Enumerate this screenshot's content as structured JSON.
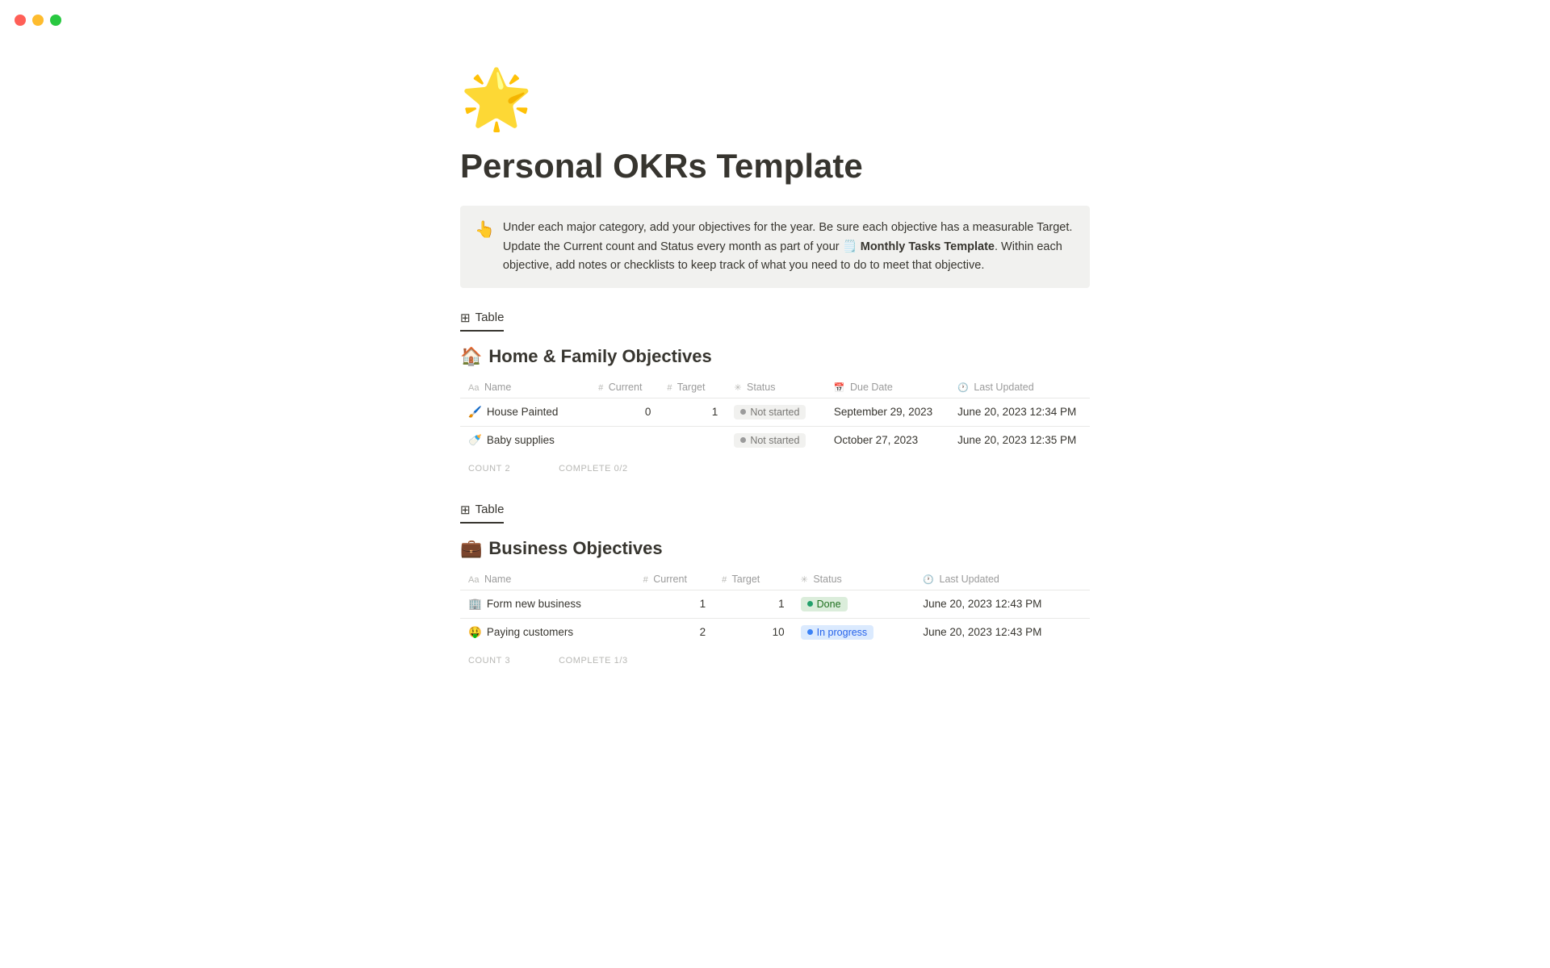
{
  "window": {
    "close_label": "close",
    "minimize_label": "minimize",
    "maximize_label": "maximize"
  },
  "page": {
    "icon": "🌟",
    "title": "Personal OKRs Template"
  },
  "callout": {
    "icon": "👆",
    "text_parts": [
      "Under each major category, add your objectives for the year. Be sure each objective has a measurable Target. Update the Current count and Status every month as part of your ",
      "🗒️ Monthly Tasks Template",
      ". Within each objective, add notes or checklists to keep track of what you need to do to meet that objective."
    ]
  },
  "sections": [
    {
      "tab_label": "Table",
      "heading_icon": "🏠",
      "heading": "Home & Family Objectives",
      "columns": [
        {
          "icon": "Aa",
          "label": "Name"
        },
        {
          "icon": "#",
          "label": "Current"
        },
        {
          "icon": "#",
          "label": "Target"
        },
        {
          "icon": "✳️",
          "label": "Status"
        },
        {
          "icon": "📅",
          "label": "Due Date"
        },
        {
          "icon": "🕐",
          "label": "Last Updated"
        }
      ],
      "rows": [
        {
          "icon": "🖌️",
          "name": "House Painted",
          "current": "0",
          "target": "1",
          "status": "Not started",
          "status_type": "not-started",
          "due_date": "September 29, 2023",
          "last_updated": "June 20, 2023 12:34 PM"
        },
        {
          "icon": "🍼",
          "name": "Baby supplies",
          "current": "",
          "target": "",
          "status": "Not started",
          "status_type": "not-started",
          "due_date": "October 27, 2023",
          "last_updated": "June 20, 2023 12:35 PM"
        }
      ],
      "footer": {
        "count_label": "COUNT",
        "count_value": "2",
        "complete_label": "COMPLETE",
        "complete_value": "0/2"
      }
    },
    {
      "tab_label": "Table",
      "heading_icon": "💼",
      "heading": "Business Objectives",
      "columns": [
        {
          "icon": "Aa",
          "label": "Name"
        },
        {
          "icon": "#",
          "label": "Current"
        },
        {
          "icon": "#",
          "label": "Target"
        },
        {
          "icon": "✳️",
          "label": "Status"
        },
        {
          "icon": "🕐",
          "label": "Last Updated"
        }
      ],
      "rows": [
        {
          "icon": "🏢",
          "name": "Form new business",
          "current": "1",
          "target": "1",
          "status": "Done",
          "status_type": "done",
          "due_date": "",
          "last_updated": "June 20, 2023 12:43 PM"
        },
        {
          "icon": "🤑",
          "name": "Paying customers",
          "current": "2",
          "target": "10",
          "status": "In progress",
          "status_type": "in-progress",
          "due_date": "",
          "last_updated": "June 20, 2023 12:43 PM"
        }
      ],
      "footer": {
        "count_label": "COUNT",
        "count_value": "3",
        "complete_label": "COMPLETE",
        "complete_value": "1/3"
      }
    }
  ]
}
